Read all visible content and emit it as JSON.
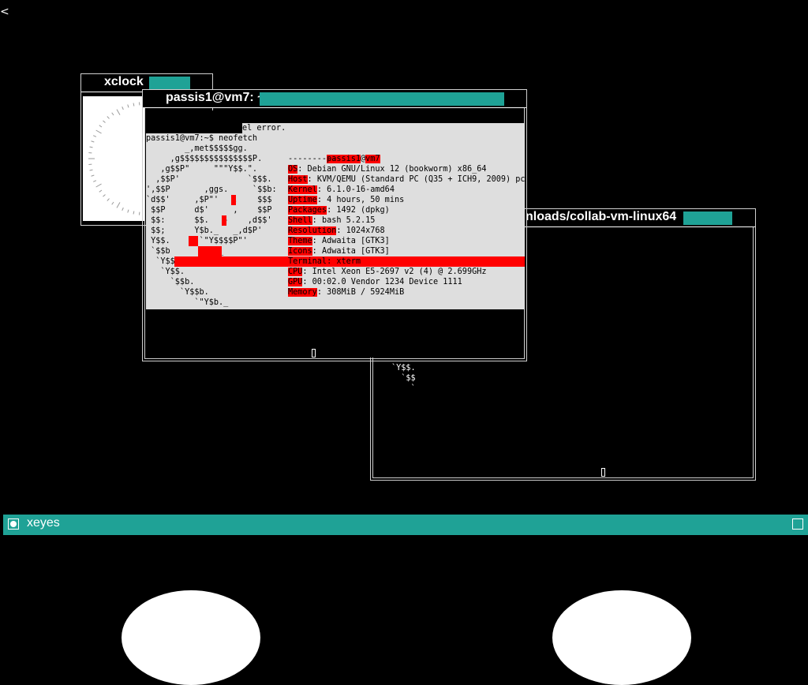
{
  "xclock": {
    "title": "xclock"
  },
  "xterm_main": {
    "title": "passis1@vm7: ~",
    "prev_output": "el error.",
    "prompt_line": "passis1@vm7:~$ neofetch",
    "user": "passis1",
    "at": "@",
    "host": "vm7",
    "separator": "-----------",
    "info": [
      {
        "key": "OS",
        "value": ": Debian GNU/Linux 12 (bookworm) x86_64"
      },
      {
        "key": "Host",
        "value": ": KVM/QEMU (Standard PC (Q35 + ICH9, 2009) pc"
      },
      {
        "key": "Kernel",
        "value": ": 6.1.0-16-amd64"
      },
      {
        "key": "Uptime",
        "value": ": 4 hours, 50 mins"
      },
      {
        "key": "Packages",
        "value": ": 1492 (dpkg)"
      },
      {
        "key": "Shell",
        "value": ": bash 5.2.15"
      },
      {
        "key": "Resolution",
        "value": ": 1024x768"
      },
      {
        "key": "Theme",
        "value": ": Adwaita [GTK3]"
      },
      {
        "key": "Icons",
        "value": ": Adwaita [GTK3]"
      },
      {
        "key": "Terminal",
        "value": ": xterm"
      },
      {
        "key": "CPU",
        "value": ": Intel Xeon E5-2697 v2 (4) @ 2.699GHz"
      },
      {
        "key": "GPU",
        "value": ": 00:02.0 Vendor 1234 Device 1111"
      },
      {
        "key": "Memory",
        "value": ": 308MiB / 5924MiB"
      }
    ],
    "ascii": [
      "        _,met$$$$$gg.",
      "     ,g$$$$$$$$$$$$$$$P.",
      "   ,g$$P\"     \"\"\"Y$$.\".",
      "  ,$$P'              `$$$.",
      "',$$P       ,ggs.     `$$b:",
      "`d$$'     ,$P\"'   .    $$$",
      " $$P      d$'     ,    $$P",
      " $$:      $$.   -    ,d$$'",
      " $$;      Y$b._   _,d$P'",
      " Y$$.    `.`\"Y$$$$P\"'",
      " `$$b      \"-.__",
      "  `Y$$",
      "   `Y$$.",
      "     `$$b.",
      "       `Y$$b.",
      "          `\"Y$b._"
    ]
  },
  "xterm_second": {
    "title": "nloads/collab-vm-linux64",
    "ascii": [
      "`Y$$.",
      "  `$$",
      "    `"
    ]
  },
  "xeyes": {
    "title": "xeyes"
  },
  "colors": {
    "accent": "#1fa296",
    "highlight": "#ff0000",
    "terminal_bg": "#dedede"
  }
}
